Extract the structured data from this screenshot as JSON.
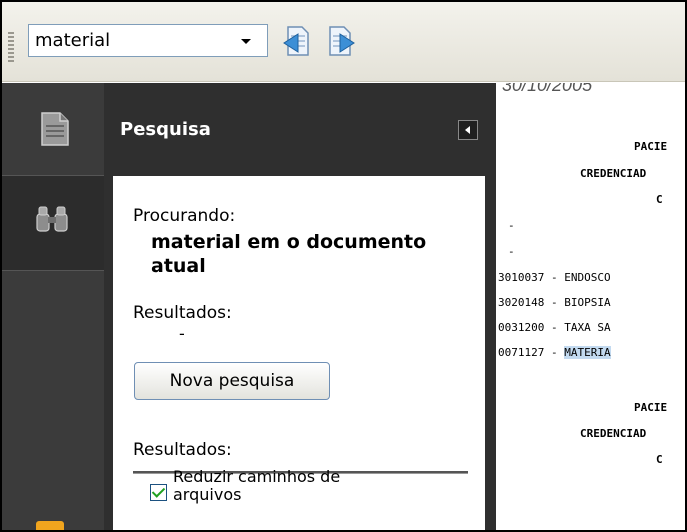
{
  "toolbar": {
    "search_value": "material",
    "prev_result_icon": "prev-result-icon",
    "next_result_icon": "next-result-icon"
  },
  "nav": {
    "pages_icon": "pages-icon",
    "search_icon": "binoculars-icon"
  },
  "panel": {
    "title": "Pesquisa",
    "searching_label": "Procurando:",
    "query_text": "material em o documento atual",
    "results_label": "Resultados:",
    "results_placeholder": "-",
    "new_search_button": "Nova pesquisa",
    "results_label_2": "Resultados:",
    "reduce_paths_label": "Reduzir caminhos de arquivos",
    "reduce_paths_checked": true
  },
  "document": {
    "top_partial": "30/10/2005",
    "lines": [
      "PACIE",
      "CREDENCIAD",
      "C",
      "-",
      "-",
      "3010037 - ENDOSCO",
      "3020148 - BIOPSIA",
      "0031200 - TAXA SA",
      "0071127 - MATERIA",
      "PACIE",
      "CREDENCIAD",
      "C"
    ],
    "highlight_text": "MATERIA",
    "highlight_color": "#c3daf0"
  },
  "colors": {
    "panel_bg": "#2f2f2f",
    "nav_bg": "#3b3b3b",
    "accent": "#f1a51e"
  }
}
